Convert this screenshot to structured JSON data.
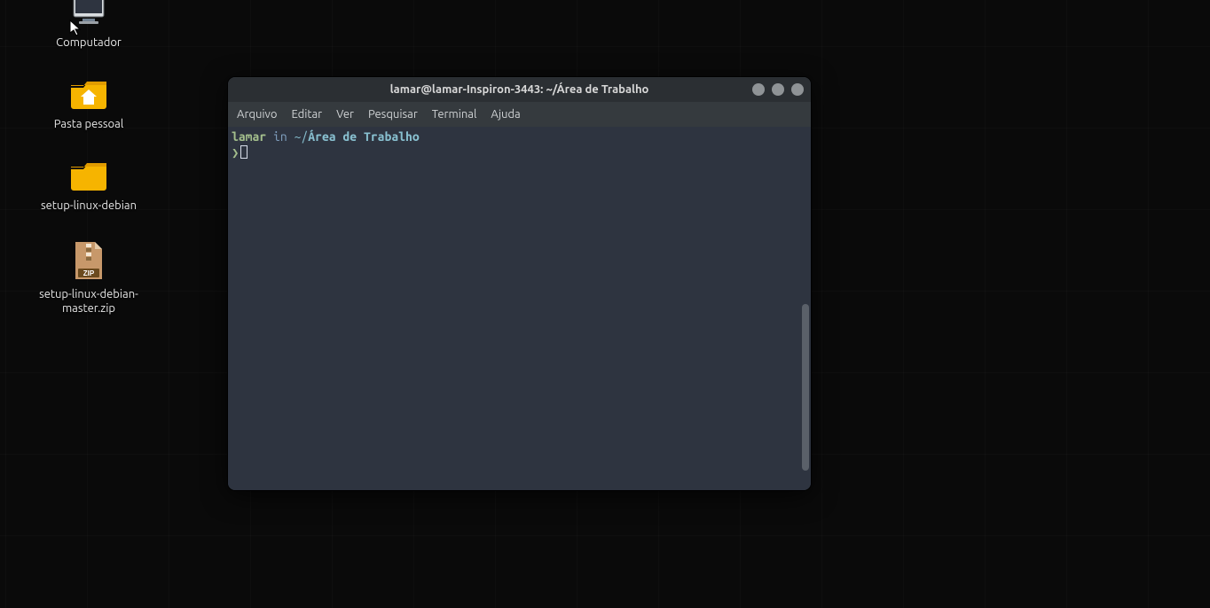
{
  "desktop": {
    "items": [
      {
        "label": "Computador",
        "icon": "computer-icon"
      },
      {
        "label": "Pasta pessoal",
        "icon": "home-folder-icon"
      },
      {
        "label": "setup-linux-debian",
        "icon": "folder-icon"
      },
      {
        "label": "setup-linux-debian-master.zip",
        "icon": "zip-file-icon"
      }
    ]
  },
  "terminal": {
    "title": "lamar@lamar-Inspiron-3443: ~/Área de Trabalho",
    "menu": {
      "arquivo": "Arquivo",
      "editar": "Editar",
      "ver": "Ver",
      "pesquisar": "Pesquisar",
      "terminal": "Terminal",
      "ajuda": "Ajuda"
    },
    "prompt": {
      "user": "lamar",
      "in_word": "in",
      "path_prefix": "~/",
      "path": "Área de Trabalho",
      "symbol": "❯"
    }
  },
  "zip_badge": "ZIP"
}
